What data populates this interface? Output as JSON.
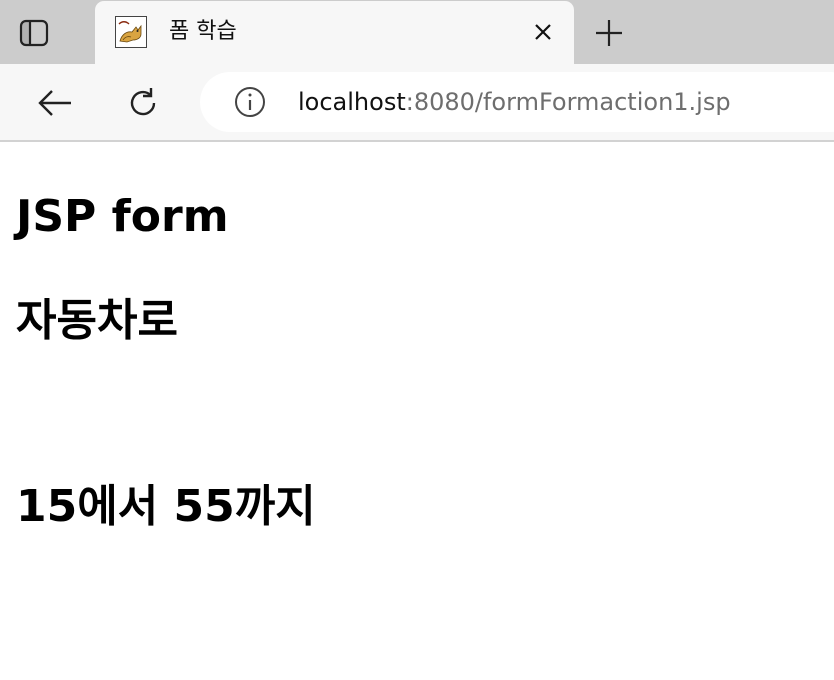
{
  "browser": {
    "tab": {
      "title": "폼 학습",
      "favicon": "tomcat-favicon"
    },
    "address": {
      "host": "localhost",
      "path": ":8080/formFormaction1.jsp"
    },
    "icons": {
      "tab_actions": "tab-actions-icon",
      "close": "close-icon",
      "new_tab": "plus-icon",
      "back": "back-arrow-icon",
      "reload": "reload-icon",
      "info": "info-icon"
    }
  },
  "page": {
    "heading_form": "JSP form",
    "heading_choice": "자동차로",
    "heading_range": "15에서 55까지"
  }
}
